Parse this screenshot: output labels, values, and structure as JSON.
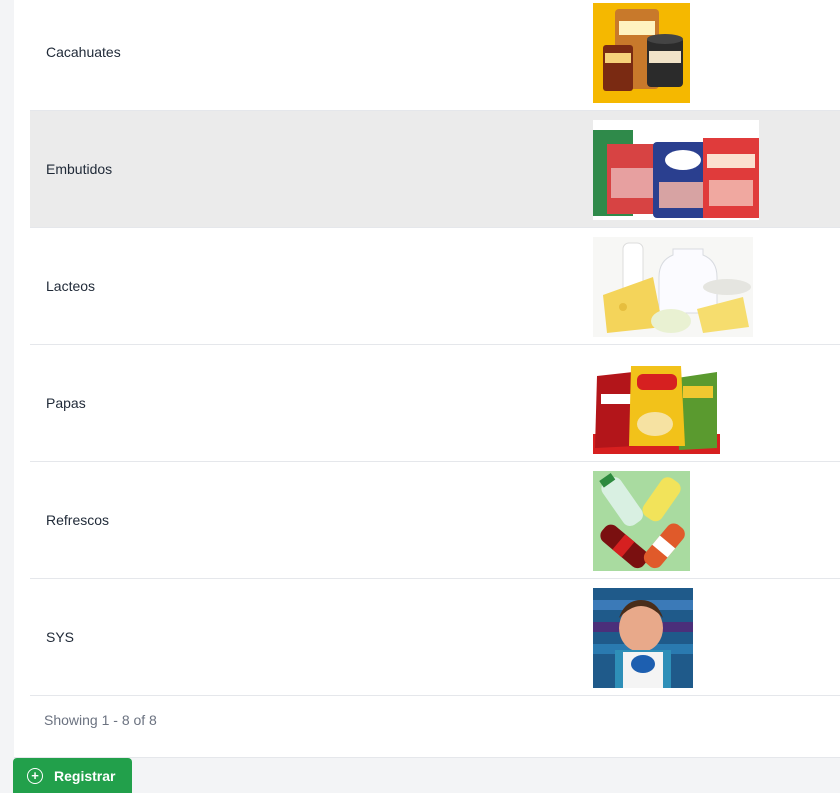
{
  "categories": [
    {
      "name": "Cacahuates",
      "image_icon": "peanut-products-image"
    },
    {
      "name": "Embutidos",
      "image_icon": "cold-cuts-image"
    },
    {
      "name": "Lacteos",
      "image_icon": "dairy-products-image"
    },
    {
      "name": "Papas",
      "image_icon": "chips-bags-image"
    },
    {
      "name": "Refrescos",
      "image_icon": "soda-bottles-image"
    },
    {
      "name": "SYS",
      "image_icon": "pg-mascot-image"
    }
  ],
  "pagination": {
    "summary": "Showing 1 - 8 of 8"
  },
  "actions": {
    "register_label": "Registrar",
    "register_icon": "plus-circle-icon"
  },
  "colors": {
    "accent": "#22a04b",
    "highlight_row": "#ebebeb"
  }
}
